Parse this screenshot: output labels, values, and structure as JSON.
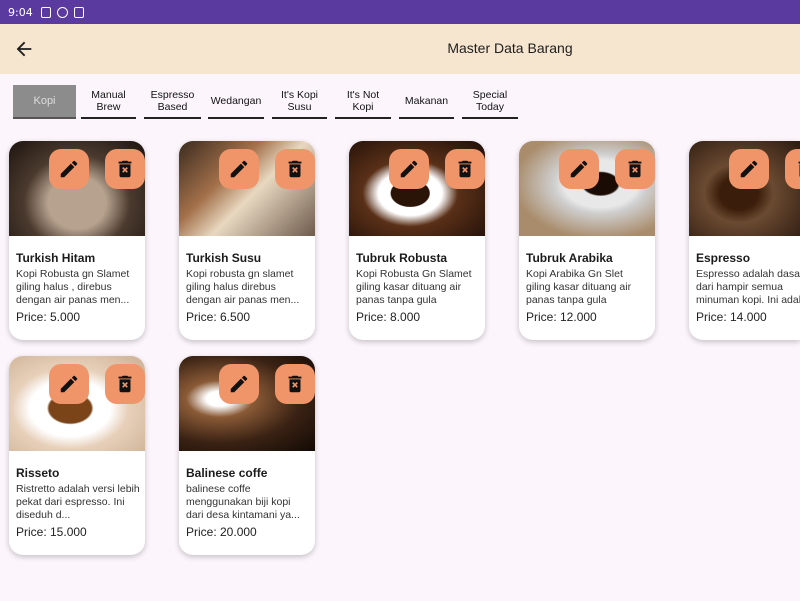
{
  "status_bar": {
    "time": "9:04"
  },
  "app_bar": {
    "title": "Master Data Barang"
  },
  "tabs": [
    {
      "label": "Kopi",
      "active": true
    },
    {
      "label": "Manual Brew",
      "active": false
    },
    {
      "label": "Espresso Based",
      "active": false
    },
    {
      "label": "Wedangan",
      "active": false
    },
    {
      "label": "It's Kopi Susu",
      "active": false
    },
    {
      "label": "It's Not Kopi",
      "active": false
    },
    {
      "label": "Makanan",
      "active": false
    },
    {
      "label": "Special Today",
      "active": false
    }
  ],
  "products": [
    {
      "name": "Turkish Hitam",
      "description": "Kopi Robusta gn Slamet giling halus , direbus dengan air panas men...",
      "price": "Price: 5.000"
    },
    {
      "name": "Turkish Susu",
      "description": "Kopi robusta gn slamet giling halus direbus dengan air panas men...",
      "price": "Price: 6.500"
    },
    {
      "name": "Tubruk Robusta",
      "description": "Kopi Robusta Gn Slamet giling kasar dituang air panas tanpa gula",
      "price": "Price: 8.000"
    },
    {
      "name": "Tubruk Arabika",
      "description": "Kopi Arabika Gn Slet giling kasar dituang air panas tanpa gula",
      "price": "Price: 12.000"
    },
    {
      "name": "Espresso",
      "description": "Espresso adalah dasar dari hampir semua minuman kopi. Ini adalah",
      "price": "Price: 14.000"
    },
    {
      "name": "Risseto",
      "description": "Ristretto adalah versi lebih pekat dari espresso. Ini diseduh d...",
      "price": "Price: 15.000"
    },
    {
      "name": "Balinese coffe",
      "description": "balinese coffe menggunakan biji kopi dari desa kintamani ya...",
      "price": "Price: 20.000"
    }
  ],
  "icons": {
    "back": "arrow-left-icon",
    "edit": "pencil-icon",
    "delete": "trash-x-icon"
  },
  "colors": {
    "status_bar": "#5a3a9e",
    "app_bar": "#f6e6d0",
    "action_button": "#f0956a",
    "active_tab": "#8c8c8c",
    "background": "#fcf6fc"
  }
}
